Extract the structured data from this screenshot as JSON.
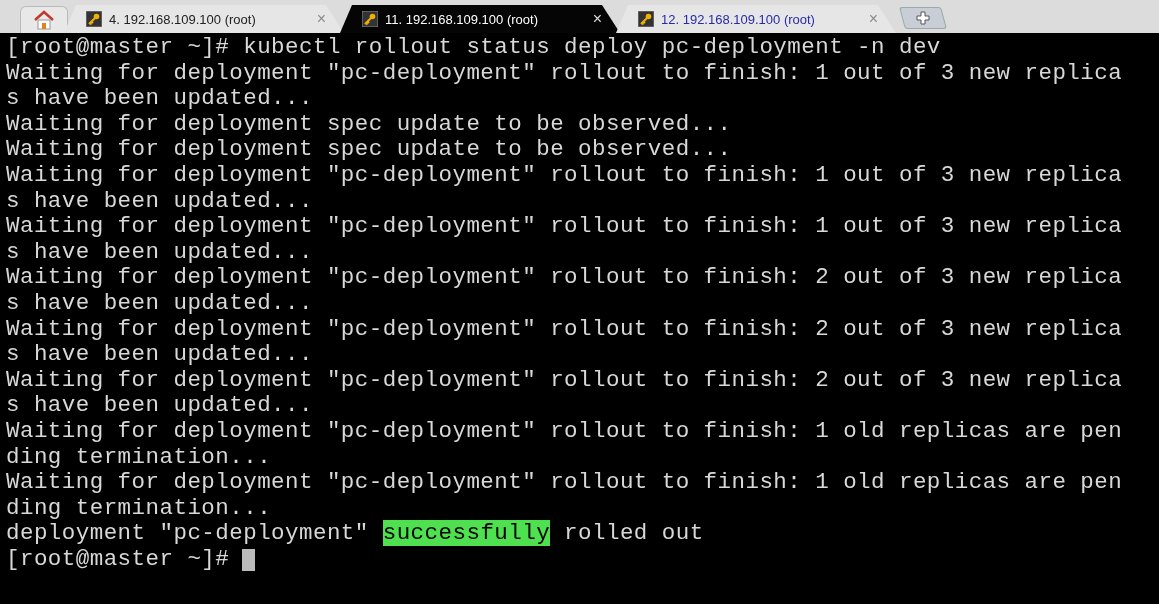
{
  "tabs": [
    {
      "kind": "home",
      "selected": false
    },
    {
      "kind": "session",
      "label": "4. 192.168.109.100 (root)",
      "selected": false,
      "unread": false,
      "close": "×"
    },
    {
      "kind": "session",
      "label": "11. 192.168.109.100 (root)",
      "selected": true,
      "unread": false,
      "close": "×"
    },
    {
      "kind": "session",
      "label": "12. 192.168.109.100 (root)",
      "selected": false,
      "unread": true,
      "close": "×"
    },
    {
      "kind": "new"
    }
  ],
  "terminal": {
    "lines": [
      {
        "text": "[root@master ~]# kubectl rollout status deploy pc-deployment -n dev"
      },
      {
        "text": "Waiting for deployment \"pc-deployment\" rollout to finish: 1 out of 3 new replica"
      },
      {
        "text": "s have been updated..."
      },
      {
        "text": "Waiting for deployment spec update to be observed..."
      },
      {
        "text": "Waiting for deployment spec update to be observed..."
      },
      {
        "text": "Waiting for deployment \"pc-deployment\" rollout to finish: 1 out of 3 new replica"
      },
      {
        "text": "s have been updated..."
      },
      {
        "text": "Waiting for deployment \"pc-deployment\" rollout to finish: 1 out of 3 new replica"
      },
      {
        "text": "s have been updated..."
      },
      {
        "text": "Waiting for deployment \"pc-deployment\" rollout to finish: 2 out of 3 new replica"
      },
      {
        "text": "s have been updated..."
      },
      {
        "text": "Waiting for deployment \"pc-deployment\" rollout to finish: 2 out of 3 new replica"
      },
      {
        "text": "s have been updated..."
      },
      {
        "text": "Waiting for deployment \"pc-deployment\" rollout to finish: 2 out of 3 new replica"
      },
      {
        "text": "s have been updated..."
      },
      {
        "text": "Waiting for deployment \"pc-deployment\" rollout to finish: 1 old replicas are pen"
      },
      {
        "text": "ding termination..."
      },
      {
        "text": "Waiting for deployment \"pc-deployment\" rollout to finish: 1 old replicas are pen"
      },
      {
        "text": "ding termination..."
      },
      {
        "segments": [
          {
            "text": "deployment \"pc-deployment\" ",
            "highlighted": false
          },
          {
            "text": "successfully",
            "highlighted": true
          },
          {
            "text": " rolled out",
            "highlighted": false
          }
        ]
      }
    ],
    "prompt": "[root@master ~]#"
  }
}
